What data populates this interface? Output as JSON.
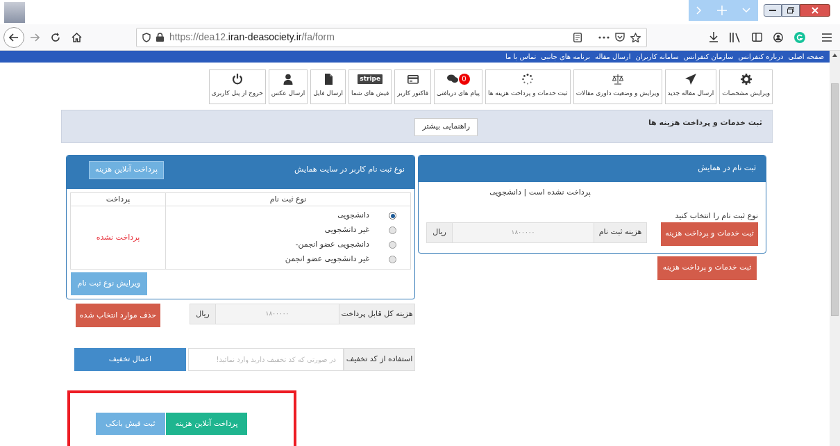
{
  "browser": {
    "url": {
      "prefix": "https://dea12.",
      "domain": "iran-deasociety.ir",
      "path": "/fa/form"
    }
  },
  "nav": [
    "صفحه اصلی",
    "درباره کنفرانس",
    "سازمان کنفرانس",
    "سامانه کاربران",
    "ارسال مقاله",
    "برنامه های جانبی",
    "تماس با ما"
  ],
  "tiles": [
    {
      "label": "ویرایش مشخصات",
      "kind": "gear"
    },
    {
      "label": "ارسال مقاله جدید",
      "kind": "plane"
    },
    {
      "label": "ویرایش و وضعیت داوری مقالات",
      "kind": "scales"
    },
    {
      "label": "ثبت خدمات و پرداخت هزینه ها",
      "kind": "spinner"
    },
    {
      "label": "پیام های دریافتی",
      "kind": "chat",
      "badge": "0"
    },
    {
      "label": "فاکتور کاربر",
      "kind": "card"
    },
    {
      "label": "فیش های شما",
      "kind": "stripe",
      "logo_text": "stripe"
    },
    {
      "label": "ارسال فایل",
      "kind": "file"
    },
    {
      "label": "ارسال عکس",
      "kind": "user"
    },
    {
      "label": "خروج از پنل کاربری",
      "kind": "power"
    }
  ],
  "page_header": {
    "title": "ثبت خدمات و پرداخت هزینه ها",
    "guide_button": "راهنمایی بیشتر"
  },
  "registration_card": {
    "title": "ثبت نام در همایش",
    "status": "پرداخت نشده است | دانشجویی",
    "prompt": "نوع ثبت نام را انتخاب کنید",
    "submit_button": "ثبت خدمات و پرداخت هزینه",
    "fee": {
      "label": "هزینه ثبت نام",
      "value": "۱۸۰۰۰۰۰",
      "unit": "ریال"
    }
  },
  "below_card_button": "ثبت خدمات و پرداخت هزینه",
  "type_card": {
    "title": "نوع ثبت نام کاربر در سایت همایش",
    "online_button": "پرداخت آنلاین هزینه",
    "columns": [
      "نوع ثبت نام",
      "پرداخت"
    ],
    "options": [
      {
        "label": "دانشجویی",
        "selected": true
      },
      {
        "label": "غیر دانشجویی",
        "selected": false
      },
      {
        "label": "دانشجویی عضو انجمن-",
        "selected": false
      },
      {
        "label": "غیر دانشجویی عضو انجمن",
        "selected": false
      }
    ],
    "payment_status": "پرداخت نشده",
    "edit_button": "ویرایش نوع ثبت نام"
  },
  "total": {
    "label": "هزینه کل قابل پرداخت",
    "value": "۱۸۰۰۰۰۰",
    "unit": "ریال",
    "delete_button": "حذف موارد انتخاب شده"
  },
  "discount": {
    "label": "استفاده از کد تخفیف",
    "placeholder": "در صورتی که کد تخفیف دارید وارد نمائید!",
    "apply_button": "اعمال تخفیف"
  },
  "highlighted_buttons": [
    {
      "label": "پرداخت آنلاین هزینه",
      "kind": "online"
    },
    {
      "label": "ثبت فیش بانکی",
      "kind": "bank"
    }
  ]
}
